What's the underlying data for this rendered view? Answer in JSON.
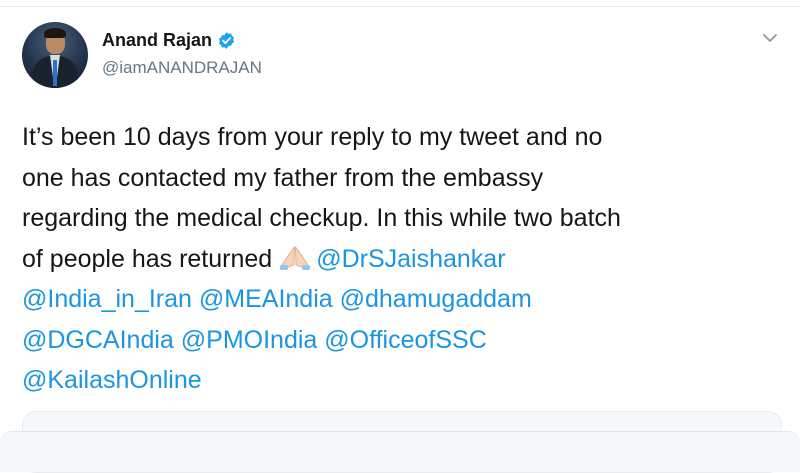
{
  "tweet": {
    "author": {
      "display_name": "Anand Rajan",
      "handle": "@iamANANDRAJAN",
      "verified": true
    },
    "text_lines": [
      [
        {
          "t": "It’s been 10 days from your reply to my tweet and no",
          "k": "text"
        }
      ],
      [
        {
          "t": "one has contacted my father from the embassy",
          "k": "text"
        }
      ],
      [
        {
          "t": "regarding the medical checkup. In this while two batch",
          "k": "text"
        }
      ],
      [
        {
          "t": "of people has returned",
          "k": "text"
        },
        {
          "t": "",
          "k": "emoji",
          "icon": "folded-hands-emoji"
        },
        {
          "t": "@DrSJaishankar",
          "k": "mention"
        }
      ],
      [
        {
          "t": "@India_in_Iran",
          "k": "mention"
        },
        {
          "t": " ",
          "k": "text"
        },
        {
          "t": "@MEAIndia",
          "k": "mention"
        },
        {
          "t": " ",
          "k": "text"
        },
        {
          "t": "@dhamugaddam",
          "k": "mention"
        }
      ],
      [
        {
          "t": "@DGCAIndia",
          "k": "mention"
        },
        {
          "t": " ",
          "k": "text"
        },
        {
          "t": "@PMOIndia",
          "k": "mention"
        },
        {
          "t": " ",
          "k": "text"
        },
        {
          "t": "@OfficeofSSC",
          "k": "mention"
        }
      ],
      [
        {
          "t": "@KailashOnline",
          "k": "mention"
        }
      ]
    ]
  },
  "icons": {
    "verified": "verified-badge-icon",
    "caret": "chevron-down-icon",
    "avatar": "avatar"
  },
  "colors": {
    "text": "#14171a",
    "secondary": "#657786",
    "mention": "#1b95e0",
    "verified": "#1da1f2",
    "card_bg": "#f5f8fa"
  }
}
